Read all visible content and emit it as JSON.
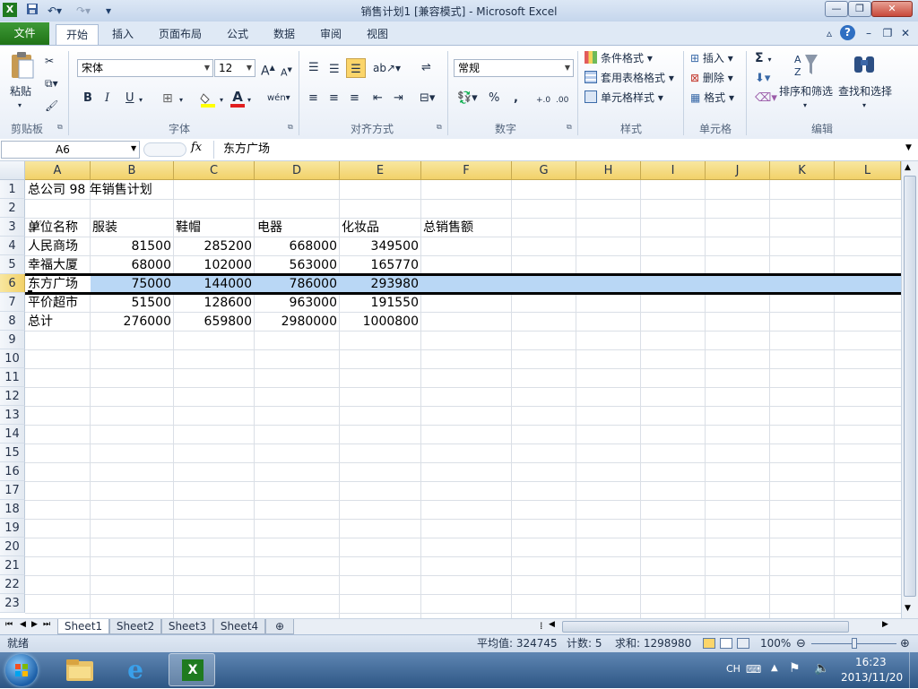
{
  "window": {
    "title": "销售计划1  [兼容模式] - Microsoft Excel",
    "min_label": "—",
    "max_label": "❐",
    "close_label": "✕"
  },
  "ribbon_tabs": [
    "文件",
    "开始",
    "插入",
    "页面布局",
    "公式",
    "数据",
    "审阅",
    "视图"
  ],
  "ribbon": {
    "clipboard": {
      "paste": "粘贴",
      "group": "剪贴板"
    },
    "font": {
      "name": "宋体",
      "size": "12",
      "bold": "B",
      "italic": "I",
      "underline": "U",
      "group": "字体",
      "grow": "A",
      "shrink": "A",
      "font_color": "A",
      "phonetic": "wén"
    },
    "alignment": {
      "group": "对齐方式"
    },
    "number": {
      "format": "常规",
      "percent": "%",
      "comma": ",",
      "group": "数字"
    },
    "styles": {
      "conditional": "条件格式",
      "table": "套用表格格式",
      "cell": "单元格样式",
      "group": "样式"
    },
    "cells": {
      "insert": "插入",
      "delete": "删除",
      "format": "格式",
      "group": "单元格"
    },
    "editing": {
      "sum": "Σ",
      "sort": "排序和筛选",
      "find": "查找和选择",
      "group": "编辑"
    }
  },
  "formula_bar": {
    "name_box": "A6",
    "fx": "fx",
    "content": "东方广场"
  },
  "columns": [
    "A",
    "B",
    "C",
    "D",
    "E",
    "F",
    "G",
    "H",
    "I",
    "J",
    "K",
    "L"
  ],
  "rows": [
    "1",
    "2",
    "3",
    "4",
    "5",
    "6",
    "7",
    "8",
    "9",
    "10",
    "11",
    "12",
    "13",
    "14",
    "15",
    "16",
    "17",
    "18",
    "19",
    "20",
    "21",
    "22",
    "23"
  ],
  "sheet": {
    "title": "总公司 98 年销售计划",
    "headers": [
      "单位名称",
      "服装",
      "鞋帽",
      "电器",
      "化妆品",
      "总销售额"
    ],
    "data": [
      [
        "人民商场",
        "81500",
        "285200",
        "668000",
        "349500"
      ],
      [
        "幸福大厦",
        "68000",
        "102000",
        "563000",
        "165770"
      ],
      [
        "东方广场",
        "75000",
        "144000",
        "786000",
        "293980"
      ],
      [
        "平价超市",
        "51500",
        "128600",
        "963000",
        "191550"
      ],
      [
        "总计",
        "276000",
        "659800",
        "2980000",
        "1000800"
      ]
    ]
  },
  "sheet_tabs": [
    "Sheet1",
    "Sheet2",
    "Sheet3",
    "Sheet4"
  ],
  "status": {
    "ready": "就绪",
    "average": "平均值: 324745",
    "count": "计数: 5",
    "sum": "求和: 1298980",
    "zoom": "100%"
  },
  "taskbar": {
    "lang": "CH",
    "time": "16:23",
    "date": "2013/11/20"
  },
  "colors": {
    "excel_green": "#207317",
    "header_selected": "#f2d169",
    "selection": "#b9d7f5"
  }
}
